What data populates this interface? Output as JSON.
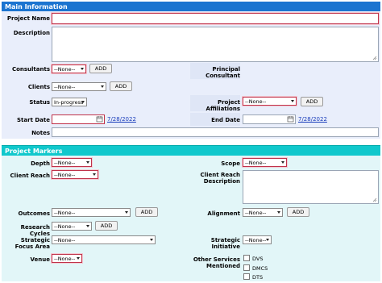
{
  "main": {
    "header": "Main Information",
    "project_name_label": "Project Name",
    "description_label": "Description",
    "consultants_label": "Consultants",
    "consultants_value": "--None--",
    "principal_consultant_label": "Principal Consultant",
    "clients_label": "Clients",
    "clients_value": "--None--",
    "status_label": "Status",
    "status_value": "In-progress",
    "project_affiliations_label": "Project Affiliations",
    "project_affiliations_value": "--None--",
    "start_date_label": "Start Date",
    "start_date_link": "7/28/2022",
    "end_date_label": "End Date",
    "end_date_link": "7/28/2022",
    "notes_label": "Notes",
    "add_label": "ADD"
  },
  "markers": {
    "header": "Project Markers",
    "depth_label": "Depth",
    "depth_value": "--None--",
    "scope_label": "Scope",
    "scope_value": "--None--",
    "client_reach_label": "Client Reach",
    "client_reach_value": "--None--",
    "client_reach_description_label": "Client Reach Description",
    "outcomes_label": "Outcomes",
    "outcomes_value": "--None--",
    "alignment_label": "Alignment",
    "alignment_value": "--None--",
    "research_cycles_label": "Research Cycles",
    "research_cycles_value": "--None--",
    "strategic_focus_area_label": "Strategic Focus Area",
    "strategic_focus_area_value": "--None--",
    "strategic_initiative_label": "Strategic Initiative",
    "strategic_initiative_value": "--None--",
    "venue_label": "Venue",
    "venue_value": "--None--",
    "other_services_label": "Other Services Mentioned",
    "other_services_options": [
      "DVS",
      "DMCS",
      "DTS"
    ],
    "add_label": "ADD"
  },
  "colors": {
    "main_header": "#1b74d0",
    "markers_header": "#10c8cc",
    "required_border": "#c0324a",
    "link": "#1a3dbb"
  }
}
